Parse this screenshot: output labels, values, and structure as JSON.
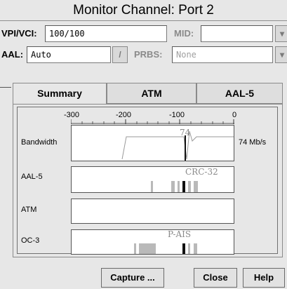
{
  "window": {
    "title": "Monitor Channel: Port 2"
  },
  "fields": {
    "vpivci_label": "VPI/VCI:",
    "vpivci_value": "100/100",
    "mid_label": "MID:",
    "mid_value": "",
    "aal_label": "AAL:",
    "aal_value": "Auto",
    "prbs_label": "PRBS:",
    "prbs_value": "None"
  },
  "tabs": [
    {
      "label": "Summary",
      "active": true
    },
    {
      "label": "ATM",
      "active": false
    },
    {
      "label": "AAL-5",
      "active": false
    }
  ],
  "scale": {
    "ticks": [
      "-300",
      "-200",
      "-100",
      "0"
    ]
  },
  "rows": {
    "bandwidth": {
      "label": "Bandwidth",
      "value_label": "74",
      "unit_label": "74 Mb/s"
    },
    "aal5": {
      "label": "AAL-5",
      "overlay": "CRC-32"
    },
    "atm": {
      "label": "ATM"
    },
    "oc3": {
      "label": "OC-3",
      "overlay": "P-AIS"
    }
  },
  "buttons": {
    "capture": "Capture ...",
    "close": "Close",
    "help": "Help"
  },
  "icons": {
    "dropdown": "dropdown-arrow-icon"
  },
  "colors": {
    "background": "#e7e7e7",
    "field": "#ffffff",
    "bars": "#b9b9b9",
    "marker": "#111111"
  }
}
